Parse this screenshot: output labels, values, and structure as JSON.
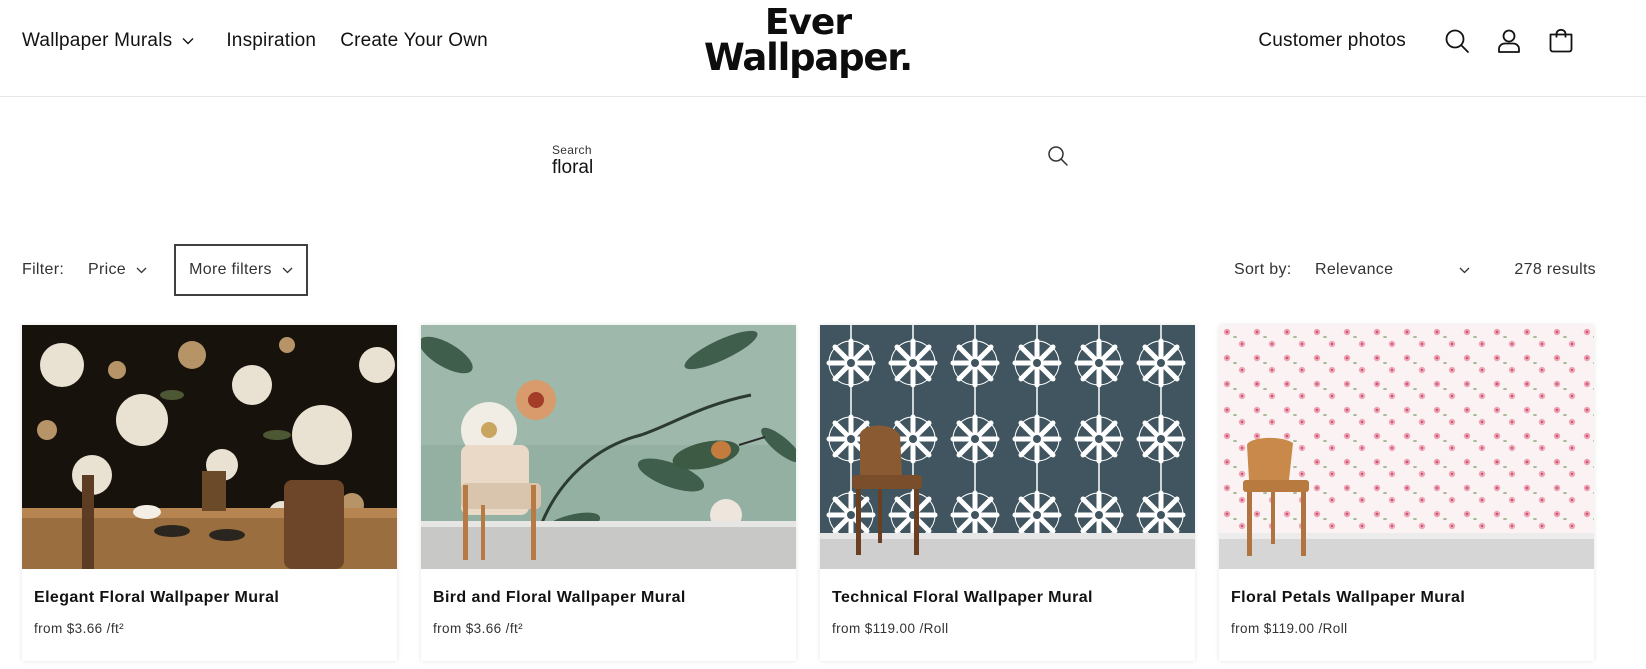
{
  "header": {
    "nav_left": {
      "murals": "Wallpaper Murals",
      "inspiration": "Inspiration",
      "create": "Create Your Own"
    },
    "logo": {
      "line1": "Ever",
      "line2": "Wallpaper."
    },
    "customer_photos": "Customer photos",
    "icons": [
      "search-icon",
      "account-icon",
      "cart-icon"
    ]
  },
  "search": {
    "label": "Search",
    "value": "floral"
  },
  "filters": {
    "label": "Filter:",
    "price": "Price",
    "more": "More filters",
    "sort_label": "Sort by:",
    "sort_value": "Relevance",
    "results": "278 results"
  },
  "products": [
    {
      "title": "Elegant Floral Wallpaper Mural",
      "price": "from $3.66 /ft²"
    },
    {
      "title": "Bird and Floral Wallpaper Mural",
      "price": "from $3.66 /ft²"
    },
    {
      "title": "Technical Floral Wallpaper Mural",
      "price": "from $119.00 /Roll"
    },
    {
      "title": "Floral Petals Wallpaper Mural",
      "price": "from $119.00 /Roll"
    }
  ],
  "colors": {
    "text": "#121212",
    "border": "#404040",
    "divider": "#e6e6e6",
    "card1_wall": "#1a1410",
    "card2_wall": "#8fae9e",
    "card3_wall": "#405560",
    "card4_wall": "#fbf3f3"
  }
}
